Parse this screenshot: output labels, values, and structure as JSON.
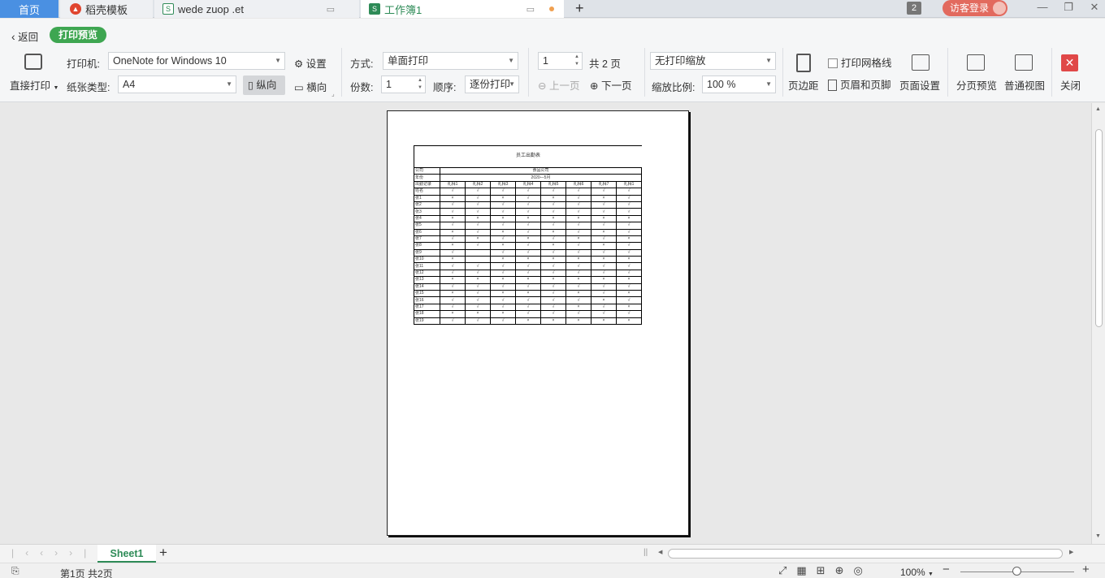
{
  "tabs": {
    "home": "首页",
    "daoke": "稻壳模板",
    "wede": "wede zuop .et",
    "workbook": "工作簿1",
    "add": "+"
  },
  "window": {
    "count_badge": "2",
    "login": "访客登录"
  },
  "toolbar": {
    "back": "返回",
    "preview_pill": "打印预览",
    "direct_print": "直接打印",
    "printer_label": "打印机:",
    "printer_value": "OneNote for Windows 10",
    "settings": "设置",
    "paper_label": "纸张类型:",
    "paper_value": "A4",
    "portrait": "纵向",
    "landscape": "横向",
    "mode_label": "方式:",
    "mode_value": "单面打印",
    "copies_label": "份数:",
    "copies_value": "1",
    "order_label": "顺序:",
    "order_value": "逐份打印",
    "page_value": "1",
    "total_pages": "共 2 页",
    "prev_page": "上一页",
    "next_page": "下一页",
    "scale_value": "无打印缩放",
    "zoom_label": "缩放比例:",
    "zoom_value": "100 %",
    "print_gridlines": "打印网格线",
    "header_footer": "页眉和页脚",
    "margins": "页边距",
    "page_setup": "页面设置",
    "page_break_preview": "分页预览",
    "normal_view": "普通视图",
    "close": "关闭"
  },
  "sheet": {
    "title": "员工出勤表",
    "company_label": "公司",
    "company_value": "食品公司",
    "month_label": "年份",
    "month_value": "2020—5月",
    "header_label": "出勤记录",
    "days": [
      "礼拜1",
      "礼拜2",
      "礼拜3",
      "礼拜4",
      "礼拜5",
      "礼拜6",
      "礼拜7",
      "礼拜1"
    ],
    "rows": [
      {
        "name": "姓名",
        "marks": [
          "√",
          "√",
          "√",
          "√",
          "√",
          "√",
          "√",
          "√"
        ]
      },
      {
        "name": "张1",
        "marks": [
          "×",
          "√",
          "×",
          "√",
          "×",
          "√",
          "×",
          "√"
        ]
      },
      {
        "name": "张2",
        "marks": [
          "√",
          "√",
          "√",
          "√",
          "√",
          "√",
          "√",
          "√"
        ]
      },
      {
        "name": "张3",
        "marks": [
          "√",
          "√",
          "√",
          "√",
          "√",
          "√",
          "√",
          "√"
        ]
      },
      {
        "name": "张4",
        "marks": [
          "×",
          "×",
          "×",
          "×",
          "×",
          "×",
          "×",
          "×"
        ]
      },
      {
        "name": "张5",
        "marks": [
          "√",
          "√",
          "√",
          "√",
          "√",
          "√",
          "√",
          "√"
        ]
      },
      {
        "name": "张6",
        "marks": [
          "×",
          "√",
          "×",
          "√",
          "×",
          "√",
          "×",
          "√"
        ]
      },
      {
        "name": "张7",
        "marks": [
          "√",
          "×",
          "√",
          "×",
          "√",
          "×",
          "√",
          "×"
        ]
      },
      {
        "name": "张8",
        "marks": [
          "×",
          "√",
          "×",
          "√",
          "×",
          "√",
          "×",
          "√"
        ]
      },
      {
        "name": "张9",
        "marks": [
          "√",
          "",
          "√",
          "√",
          "√",
          "√",
          "√",
          "√"
        ]
      },
      {
        "name": "张10",
        "marks": [
          "×",
          "",
          "×",
          "×",
          "×",
          "×",
          "×",
          "×"
        ]
      },
      {
        "name": "张11",
        "marks": [
          "√",
          "√",
          "√",
          "√",
          "√",
          "√",
          "√",
          "√"
        ]
      },
      {
        "name": "张12",
        "marks": [
          "√",
          "√",
          "√",
          "√",
          "√",
          "√",
          "√",
          "√"
        ]
      },
      {
        "name": "张13",
        "marks": [
          "×",
          "×",
          "×",
          "×",
          "×",
          "×",
          "×",
          "×"
        ]
      },
      {
        "name": "张14",
        "marks": [
          "√",
          "√",
          "√",
          "√",
          "√",
          "√",
          "√",
          "√"
        ]
      },
      {
        "name": "张15",
        "marks": [
          "×",
          "√",
          "×",
          "×",
          "√",
          "×",
          "√",
          "×"
        ]
      },
      {
        "name": "张16",
        "marks": [
          "√",
          "√",
          "√",
          "√",
          "√",
          "√",
          "×",
          "√"
        ]
      },
      {
        "name": "张17",
        "marks": [
          "√",
          "√",
          "√",
          "√",
          "√",
          "×",
          "√",
          "×"
        ]
      },
      {
        "name": "张18",
        "marks": [
          "×",
          "×",
          "×",
          "√",
          "√",
          "√",
          "√",
          "√"
        ]
      },
      {
        "name": "张19",
        "marks": [
          "√",
          "√",
          "√",
          "×",
          "×",
          "×",
          "×",
          "×"
        ]
      }
    ]
  },
  "sheet_tabs": {
    "sheet1": "Sheet1",
    "add": "+"
  },
  "status": {
    "page_info": "第1页 共2页",
    "zoom": "100%"
  },
  "colors": {
    "accent_green": "#3ea651",
    "home_tab": "#4a90e2",
    "login": "#e26a5e",
    "close_red": "#e04848"
  }
}
